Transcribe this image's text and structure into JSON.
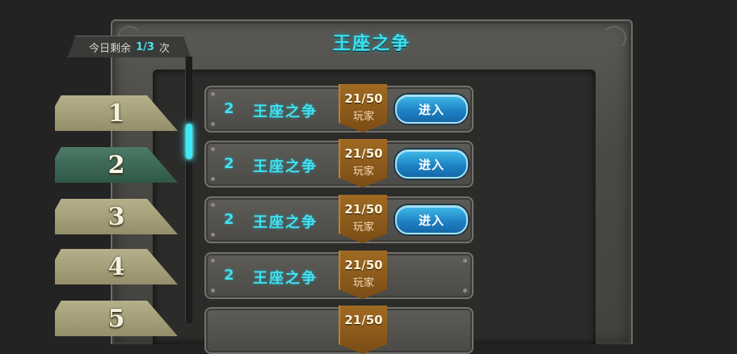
{
  "title": "王座之争",
  "remaining": {
    "prefix": "今日剩余",
    "count": "1/3",
    "suffix": "次"
  },
  "floors": [
    {
      "label": "1",
      "active": false
    },
    {
      "label": "2",
      "active": true
    },
    {
      "label": "3",
      "active": false
    },
    {
      "label": "4",
      "active": false
    },
    {
      "label": "5",
      "active": false
    }
  ],
  "rows": [
    {
      "level": "2",
      "name": "王座之争",
      "players": "21/50",
      "players_label": "玩家",
      "enter_label": "进入"
    },
    {
      "level": "2",
      "name": "王座之争",
      "players": "21/50",
      "players_label": "玩家",
      "enter_label": "进入"
    },
    {
      "level": "2",
      "name": "王座之争",
      "players": "21/50",
      "players_label": "玩家",
      "enter_label": "进入"
    },
    {
      "level": "2",
      "name": "王座之争",
      "players": "21/50",
      "players_label": "玩家"
    },
    {
      "level": "",
      "name": "",
      "players": "21/50",
      "players_label": ""
    }
  ],
  "colors": {
    "accent": "#42e0ee",
    "badge": "#8a5a1a",
    "button": "#1d7fc2"
  }
}
